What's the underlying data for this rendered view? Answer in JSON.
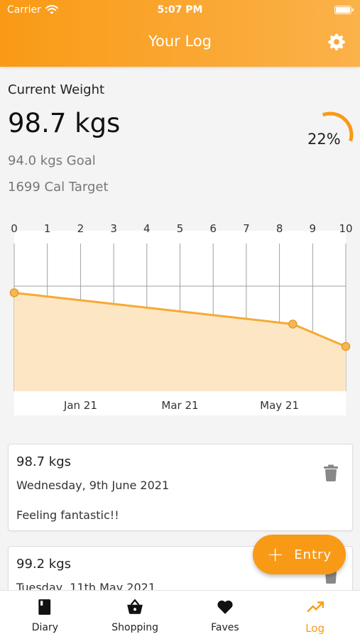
{
  "status_bar": {
    "carrier": "Carrier",
    "time": "5:07 PM"
  },
  "header": {
    "title": "Your Log"
  },
  "summary": {
    "current_weight_label": "Current Weight",
    "current_weight": "98.7 kgs",
    "goal": "94.0 kgs Goal",
    "calorie_target": "1699 Cal Target",
    "progress_text": "22%",
    "progress_fraction": 0.22
  },
  "chart_data": {
    "type": "area",
    "top_ticks": [
      "0",
      "1",
      "2",
      "3",
      "4",
      "5",
      "6",
      "7",
      "8",
      "9",
      "10"
    ],
    "bottom_ticks": [
      "Jan 21",
      "Mar 21",
      "May 21"
    ],
    "x": [
      0,
      8.4,
      10
    ],
    "y": [
      99.9,
      99.2,
      98.7
    ],
    "xlim": [
      0,
      10
    ],
    "series_color": "#f7a934",
    "fill_color": "#fde6c4"
  },
  "entries": [
    {
      "weight": "98.7 kgs",
      "date": "Wednesday, 9th June 2021",
      "note": "Feeling fantastic!!"
    },
    {
      "weight": "99.2 kgs",
      "date": "Tuesday, 11th May 2021",
      "note": ""
    }
  ],
  "fab": {
    "label": "Entry"
  },
  "tabs": [
    {
      "label": "Diary",
      "icon": "book-icon"
    },
    {
      "label": "Shopping",
      "icon": "basket-icon"
    },
    {
      "label": "Faves",
      "icon": "heart-icon"
    },
    {
      "label": "Log",
      "icon": "trending-up-icon"
    }
  ],
  "colors": {
    "accent": "#f99a16",
    "muted": "#777777"
  }
}
